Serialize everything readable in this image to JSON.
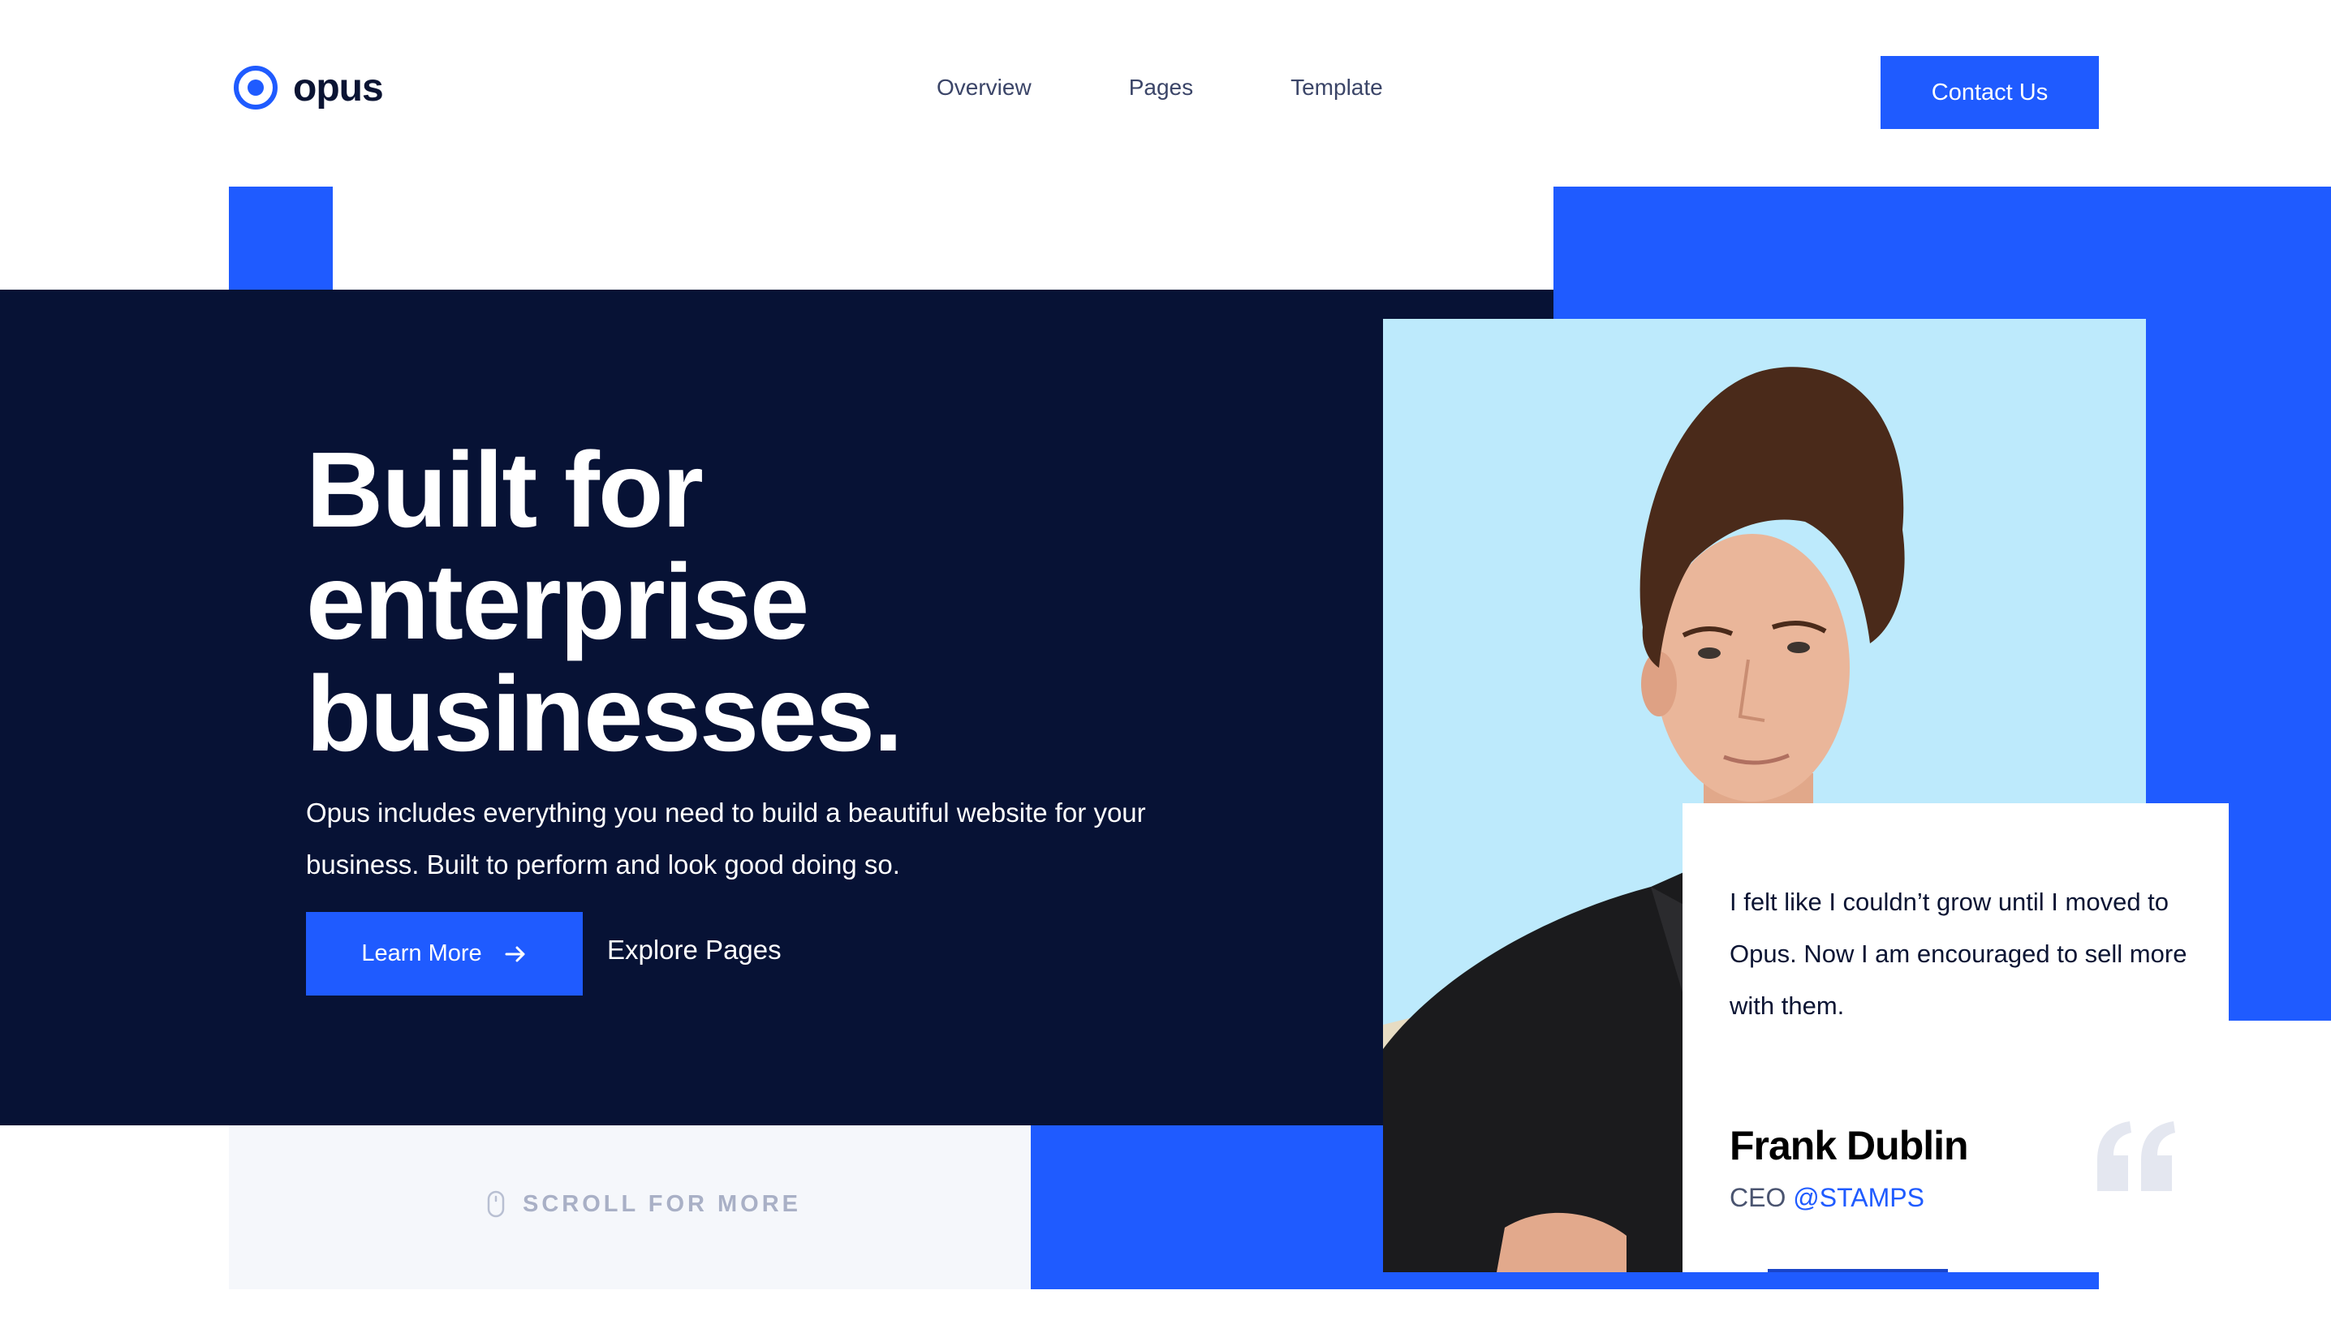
{
  "brand": {
    "name": "opus",
    "accent": "#1f5bff",
    "navy": "#071235"
  },
  "nav": {
    "items": [
      "Overview",
      "Pages",
      "Template"
    ],
    "cta": "Contact Us"
  },
  "hero": {
    "title_lines": [
      "Built for",
      "enterprise",
      "businesses."
    ],
    "subtitle": "Opus includes everything you need to build a beautiful website for your business. Built to perform and look good doing so.",
    "primary_button": "Learn More",
    "secondary_link": "Explore Pages",
    "scroll_hint": "SCROLL FOR MORE"
  },
  "testimonial": {
    "quote": "I felt like I couldn’t grow until I moved to Opus. Now I am encouraged to sell more with them.",
    "name": "Frank Dublin",
    "role": "CEO",
    "handle": "@STAMPS"
  },
  "icons": [
    "logo-ring-icon",
    "arrow-right-icon",
    "mouse-icon",
    "quote-mark-icon"
  ]
}
